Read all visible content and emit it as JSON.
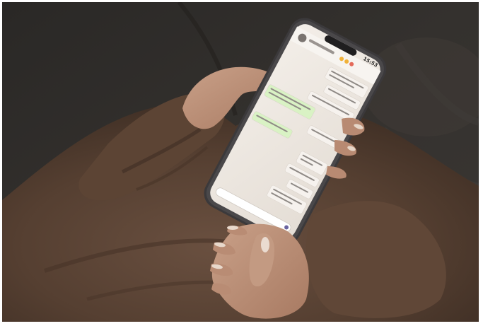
{
  "photo": {
    "description_hidden": "",
    "phone": {
      "status_time": "15:53",
      "messages": [
        {
          "side": "in",
          "text": ""
        },
        {
          "side": "in",
          "text": ""
        },
        {
          "side": "in",
          "text": ""
        },
        {
          "side": "out",
          "text": ""
        },
        {
          "side": "in",
          "text": ""
        },
        {
          "side": "out",
          "text": ""
        },
        {
          "side": "in",
          "text": ""
        },
        {
          "side": "in",
          "text": ""
        },
        {
          "side": "in",
          "text": ""
        },
        {
          "side": "in",
          "text": ""
        }
      ]
    }
  },
  "colors": {
    "couch": "#2f2c29",
    "sweater": "#5a4333",
    "skin": "#c79a82",
    "nails": "#e9d9cc",
    "phone_case": "#3c3a3c",
    "screen": "#ece6df",
    "bubble_in": "#f6f2ee",
    "bubble_out": "#d9f2c4"
  }
}
